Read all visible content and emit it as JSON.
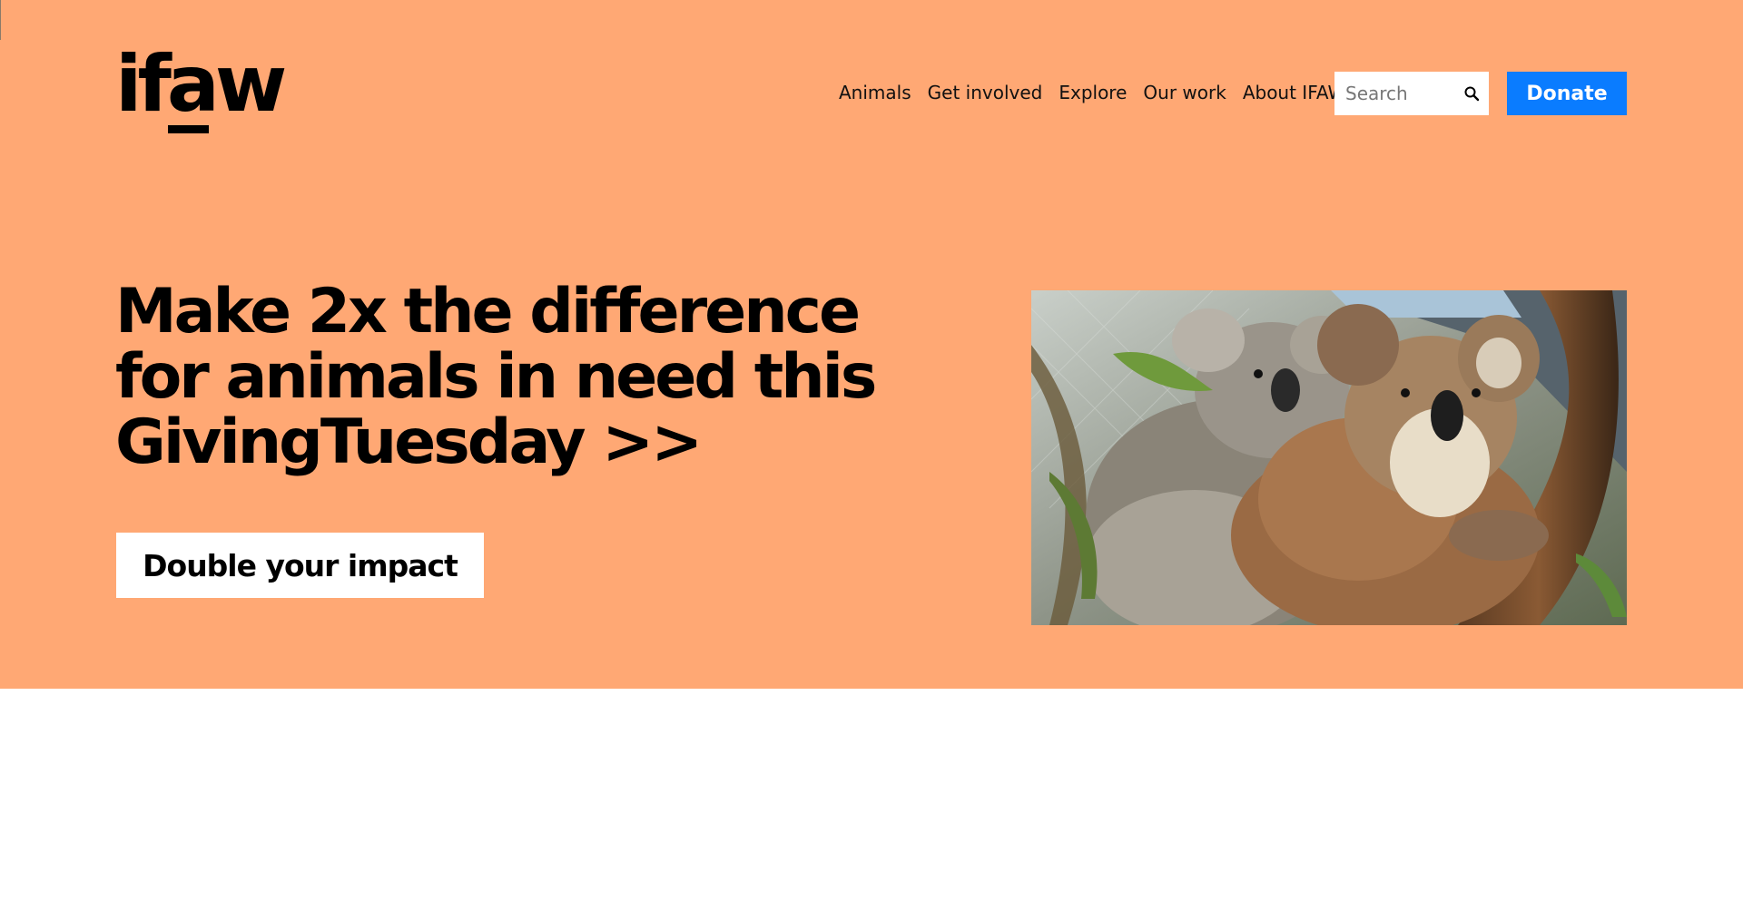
{
  "header": {
    "logo_text": "ifaw",
    "nav": [
      {
        "label": "Animals"
      },
      {
        "label": "Get involved"
      },
      {
        "label": "Explore"
      },
      {
        "label": "Our work"
      },
      {
        "label": "About IFAW"
      }
    ],
    "search": {
      "placeholder": "Search",
      "value": "",
      "icon": "search-icon"
    },
    "donate_label": "Donate"
  },
  "hero": {
    "headline": "Make 2x the difference for animals in need this GivingTuesday >>",
    "cta_label": "Double your impact",
    "image_alt": "Two koalas clinging to a eucalyptus tree branch",
    "background_color": "#ffa874"
  },
  "colors": {
    "accent": "#0a7cff",
    "hero_bg": "#ffa874"
  }
}
